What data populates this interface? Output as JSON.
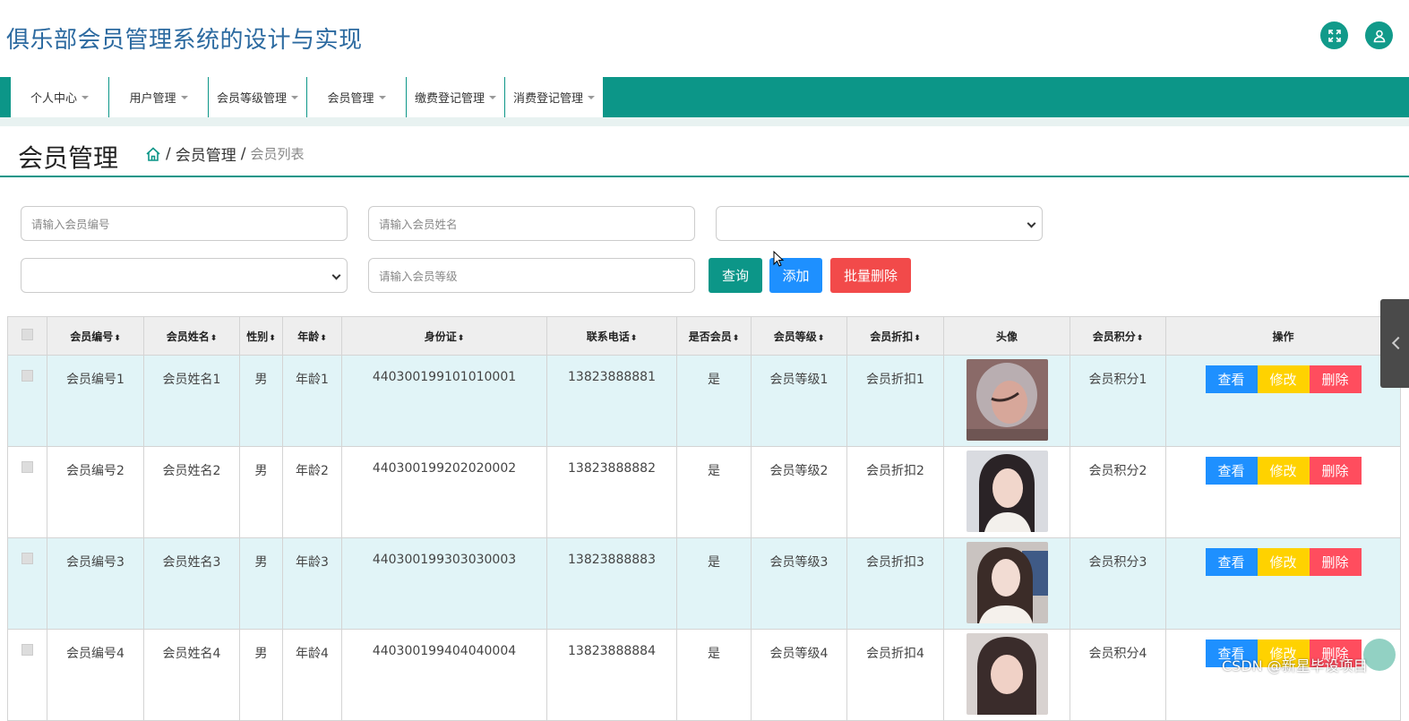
{
  "app": {
    "title": "俱乐部会员管理系统的设计与实现"
  },
  "header_icons": [
    "fullscreen-icon",
    "user-icon"
  ],
  "nav": {
    "items": [
      {
        "label": "个人中心"
      },
      {
        "label": "用户管理"
      },
      {
        "label": "会员等级管理"
      },
      {
        "label": "会员管理"
      },
      {
        "label": "缴费登记管理"
      },
      {
        "label": "消费登记管理"
      }
    ]
  },
  "page": {
    "title": "会员管理",
    "breadcrumb": {
      "sep": "/",
      "level1": "会员管理",
      "current": "会员列表"
    }
  },
  "search": {
    "member_no_placeholder": "请输入会员编号",
    "member_name_placeholder": "请输入会员姓名",
    "member_level_placeholder": "请输入会员等级",
    "select1_value": "",
    "select2_value": "",
    "query_label": "查询",
    "add_label": "添加",
    "batch_delete_label": "批量删除"
  },
  "table": {
    "sort_glyph": "⬍",
    "headers": {
      "member_no": "会员编号",
      "member_name": "会员姓名",
      "gender": "性别",
      "age": "年龄",
      "id_card": "身份证",
      "phone": "联系电话",
      "is_member": "是否会员",
      "level": "会员等级",
      "discount": "会员折扣",
      "avatar": "头像",
      "points": "会员积分",
      "ops": "操作"
    },
    "rows": [
      {
        "member_no": "会员编号1",
        "member_name": "会员姓名1",
        "gender": "男",
        "age": "年龄1",
        "id_card": "440300199101010001",
        "phone": "13823888881",
        "is_member": "是",
        "level": "会员等级1",
        "discount": "会员折扣1",
        "points": "会员积分1"
      },
      {
        "member_no": "会员编号2",
        "member_name": "会员姓名2",
        "gender": "男",
        "age": "年龄2",
        "id_card": "440300199202020002",
        "phone": "13823888882",
        "is_member": "是",
        "level": "会员等级2",
        "discount": "会员折扣2",
        "points": "会员积分2"
      },
      {
        "member_no": "会员编号3",
        "member_name": "会员姓名3",
        "gender": "男",
        "age": "年龄3",
        "id_card": "440300199303030003",
        "phone": "13823888883",
        "is_member": "是",
        "level": "会员等级3",
        "discount": "会员折扣3",
        "points": "会员积分3"
      },
      {
        "member_no": "会员编号4",
        "member_name": "会员姓名4",
        "gender": "男",
        "age": "年龄4",
        "id_card": "440300199404040004",
        "phone": "13823888884",
        "is_member": "是",
        "level": "会员等级4",
        "discount": "会员折扣4",
        "points": "会员积分4"
      }
    ],
    "ops": {
      "view": "查看",
      "edit": "修改",
      "delete": "删除"
    }
  },
  "watermark": "CSDN @新星毕设项目",
  "colors": {
    "primary": "#0c9688",
    "title_blue": "#2c6aa0",
    "btn_view": "#1e90ff",
    "btn_edit": "#ffd200",
    "btn_delete": "#ff4d5e",
    "btn_batch_delete": "#f24a4a",
    "row_alt": "#e1f4f7"
  }
}
